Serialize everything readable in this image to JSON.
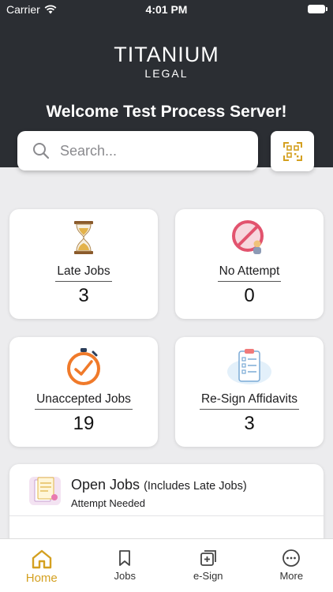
{
  "status": {
    "carrier": "Carrier",
    "time": "4:01 PM"
  },
  "brand": {
    "name": "TITANIUM",
    "sub": "LEGAL"
  },
  "welcome": "Welcome Test Process Server!",
  "search": {
    "placeholder": "Search..."
  },
  "cards": [
    {
      "label": "Late Jobs",
      "count": "3",
      "icon": "hourglass-icon"
    },
    {
      "label": "No Attempt",
      "count": "0",
      "icon": "no-attempt-icon"
    },
    {
      "label": "Unaccepted Jobs",
      "count": "19",
      "icon": "timer-icon"
    },
    {
      "label": "Re-Sign Affidavits",
      "count": "3",
      "icon": "clipboard-icon"
    }
  ],
  "open_jobs": {
    "title": "Open Jobs",
    "note": "(Includes Late Jobs)",
    "subtitle": "Attempt Needed"
  },
  "tabs": [
    {
      "label": "Home",
      "active": true
    },
    {
      "label": "Jobs",
      "active": false
    },
    {
      "label": "e-Sign",
      "active": false
    },
    {
      "label": "More",
      "active": false
    }
  ],
  "colors": {
    "header": "#2b2e33",
    "accent": "#d4a020",
    "background": "#ececee"
  }
}
